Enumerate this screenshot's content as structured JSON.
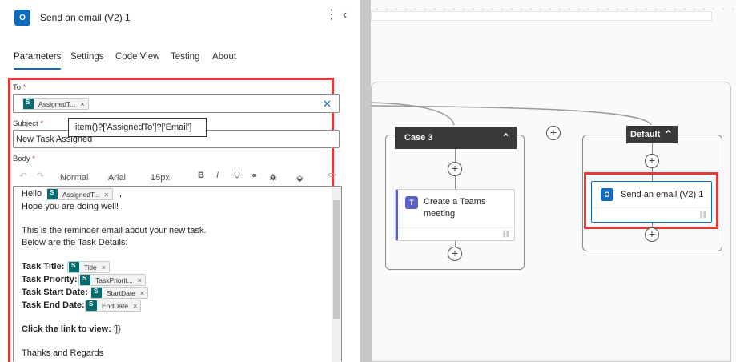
{
  "panel": {
    "title": "Send an email (V2) 1",
    "more_icon": "⋮",
    "collapse_icon": "‹",
    "tabs": [
      "Parameters",
      "Settings",
      "Code View",
      "Testing",
      "About"
    ],
    "to_label": "To",
    "to_token": "AssignedT...",
    "tooltip": "item()?['AssignedTo']?['Email']",
    "subject_label": "Subject",
    "subject_value": "New Task Assigned",
    "body_label": "Body",
    "required_mark": "*",
    "token_remove": "×",
    "clear_icon": "✕",
    "toolbar": {
      "undo": "↶",
      "redo": "↷",
      "font_style": "Normal",
      "font": "Arial",
      "size": "15px",
      "bold": "B",
      "italic": "I",
      "underline": "U",
      "link": "⚭",
      "font_color": "A",
      "highlight": "⬙",
      "code": "<>",
      "dropdown": "⌵"
    },
    "body": {
      "hello": "Hello",
      "hello_token": "AssignedT...",
      "hello_suffix": ",",
      "line2": "Hope you are doing well!",
      "line3": "This is the reminder email about your new task.",
      "line4": "Below are the Task Details:",
      "task_title_label": "Task Title:",
      "task_title_token": "Title",
      "task_priority_label": "Task Priority:",
      "task_priority_token": "TaskPriorit...",
      "task_start_label": "Task Start Date:",
      "task_start_token": "StartDate",
      "task_end_label": "Task End Date:",
      "task_end_token": "EndDate",
      "click_link": "Click the link to view:",
      "click_link_suffix": "']}",
      "thanks": "Thanks and Regards"
    }
  },
  "canvas": {
    "case3_title": "Case 3",
    "case3_action": "Create a Teams meeting",
    "default_title": "Default",
    "default_action": "Send an email (V2) 1",
    "collapse_icon": "⌃",
    "plus_icon": "+",
    "link_icon": "⛓"
  },
  "colors": {
    "accent": "#0f6cbd",
    "highlight_border": "#e03b3b",
    "teams": "#5b5fc7",
    "sharepoint": "#036c70"
  }
}
